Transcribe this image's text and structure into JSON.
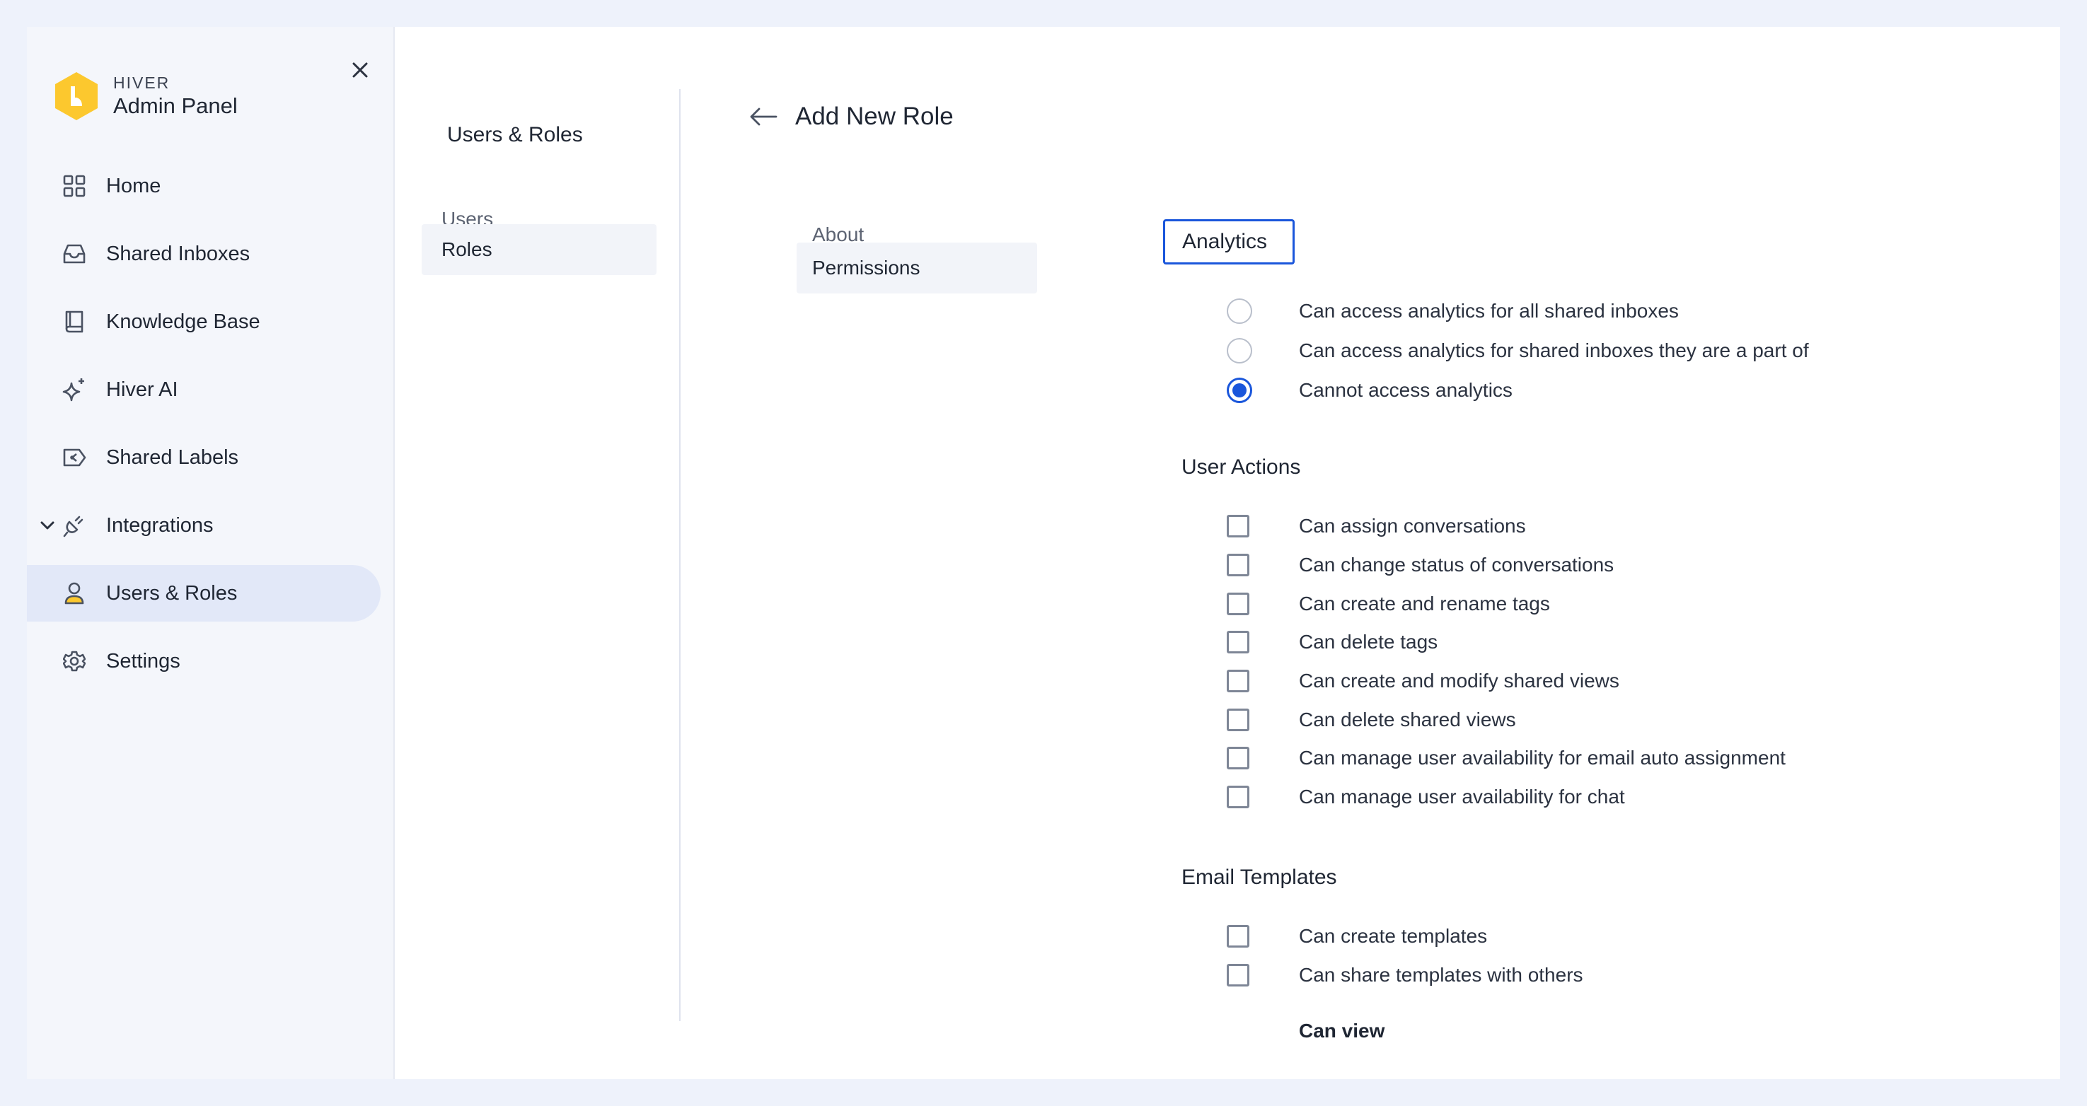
{
  "sidebar": {
    "brand_small": "HIVER",
    "brand_big": "Admin Panel",
    "items": [
      {
        "label": "Home",
        "icon": "grid-icon"
      },
      {
        "label": "Shared Inboxes",
        "icon": "inbox-icon"
      },
      {
        "label": "Knowledge Base",
        "icon": "book-icon"
      },
      {
        "label": "Hiver AI",
        "icon": "sparkle-icon"
      },
      {
        "label": "Shared Labels",
        "icon": "label-icon"
      },
      {
        "label": "Integrations",
        "icon": "plug-icon"
      },
      {
        "label": "Users & Roles",
        "icon": "user-icon"
      },
      {
        "label": "Settings",
        "icon": "gear-icon"
      }
    ],
    "brand_color": "#fcc82e",
    "active_bg": "#e2e8f8"
  },
  "subnav": {
    "title": "Users & Roles",
    "users": "Users",
    "roles": "Roles"
  },
  "main": {
    "title": "Add New Role",
    "tabs": {
      "about": "About",
      "permissions": "Permissions"
    },
    "analytics": {
      "title": "Analytics",
      "options": [
        {
          "label": "Can access analytics for all shared inboxes",
          "checked": false
        },
        {
          "label": "Can access analytics for shared inboxes they are a part of",
          "checked": false
        },
        {
          "label": "Cannot access analytics",
          "checked": true
        }
      ]
    },
    "user_actions": {
      "title": "User Actions",
      "options": [
        {
          "label": "Can assign conversations",
          "checked": false
        },
        {
          "label": "Can change status of conversations",
          "checked": false
        },
        {
          "label": "Can create and rename tags",
          "checked": false
        },
        {
          "label": "Can delete tags",
          "checked": false
        },
        {
          "label": "Can create and modify shared views",
          "checked": false
        },
        {
          "label": "Can delete shared views",
          "checked": false
        },
        {
          "label": "Can manage user availability for email auto assignment",
          "checked": false
        },
        {
          "label": "Can manage user availability for chat",
          "checked": false
        }
      ]
    },
    "email_templates": {
      "title": "Email Templates",
      "options": [
        {
          "label": "Can create templates",
          "checked": false
        },
        {
          "label": "Can share templates with others",
          "checked": false
        }
      ],
      "can_view": "Can view"
    },
    "accent_color": "#1a56db"
  }
}
